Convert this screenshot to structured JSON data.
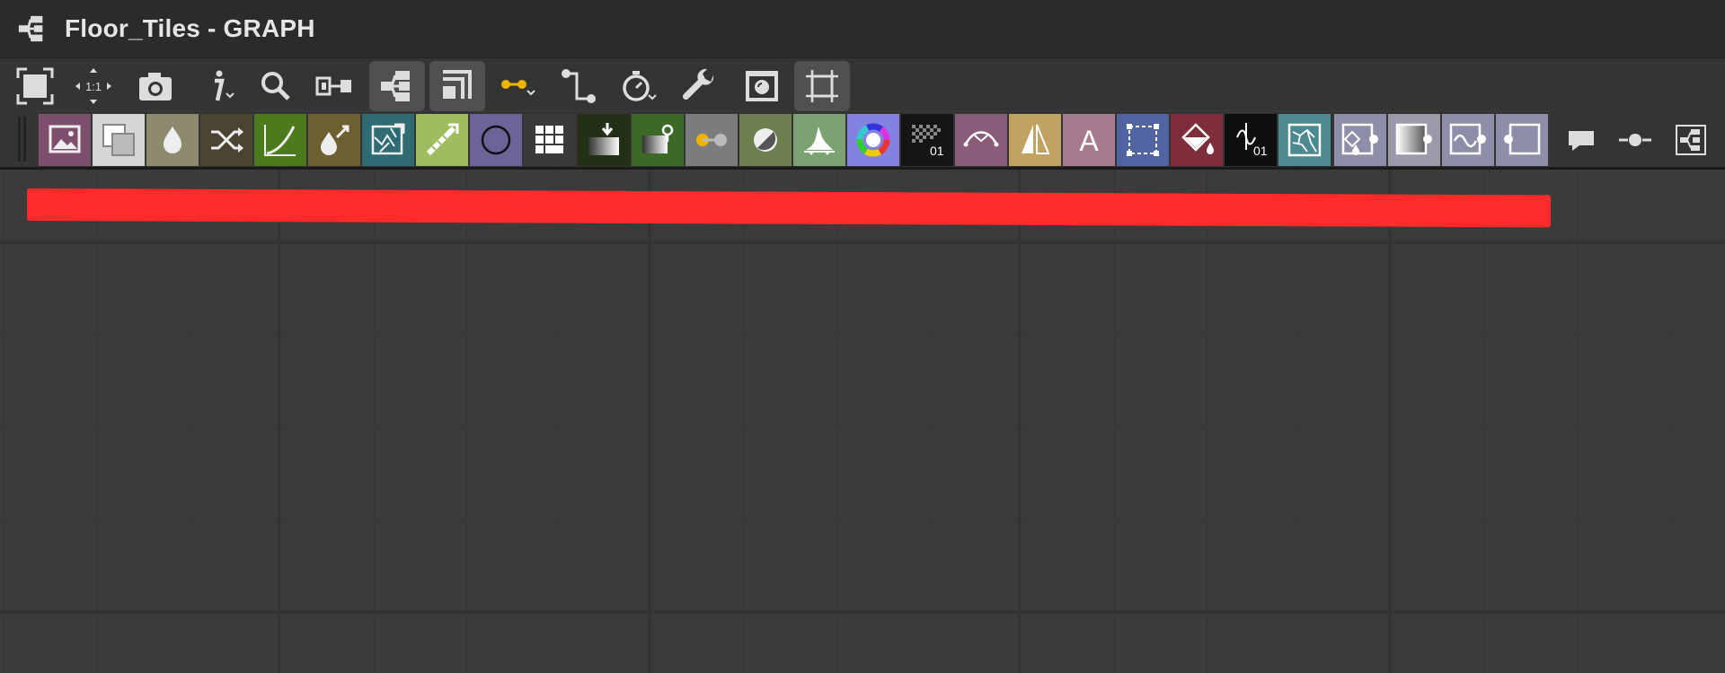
{
  "window": {
    "title": "Floor_Tiles - GRAPH",
    "title_icon": "graph-icon"
  },
  "toolbar_main": {
    "items": [
      {
        "name": "frame-all-icon",
        "active": false
      },
      {
        "name": "zoom-1-1-icon",
        "label": "1:1",
        "active": false
      },
      {
        "name": "screenshot-camera-icon",
        "active": false
      },
      {
        "name": "info-icon",
        "active": false
      },
      {
        "name": "search-icon",
        "active": false
      },
      {
        "name": "connector-icon",
        "active": false
      },
      {
        "name": "graph-layout-icon",
        "active": true
      },
      {
        "name": "stack-frames-icon",
        "active": true
      },
      {
        "name": "link-dropdown-icon",
        "active": false
      },
      {
        "name": "connection-style-icon",
        "active": false
      },
      {
        "name": "timer-icon",
        "active": false
      },
      {
        "name": "wrench-icon",
        "active": false
      },
      {
        "name": "preview-window-icon",
        "active": false
      },
      {
        "name": "frame-selection-icon",
        "active": true
      }
    ]
  },
  "toolbar_nodes": {
    "items": [
      {
        "name": "bitmap-node-icon",
        "color": "#7e4e6d"
      },
      {
        "name": "blend-node-icon",
        "color": "#d6d6d6"
      },
      {
        "name": "levels-drop-node-icon",
        "color": "#8d8a70"
      },
      {
        "name": "shuffle-node-icon",
        "color": "#4b4431"
      },
      {
        "name": "curve-node-icon",
        "color": "#4e7a1e"
      },
      {
        "name": "color-pick-node-icon",
        "color": "#6e6030"
      },
      {
        "name": "warp-node-icon",
        "color": "#2f6b72"
      },
      {
        "name": "gradient-node-icon",
        "color": "#9ebd5e"
      },
      {
        "name": "circle-shape-node-icon",
        "color": "#6c6398"
      },
      {
        "name": "grid-node-icon",
        "color": "#3a3a3a"
      },
      {
        "name": "input-node-icon",
        "color": "#233018"
      },
      {
        "name": "output-node-icon",
        "color": "#3c6a26"
      },
      {
        "name": "value-node-icon",
        "color": "#7c7c7c"
      },
      {
        "name": "grayscale-node-icon",
        "color": "#6b7f4f"
      },
      {
        "name": "histogram-node-icon",
        "color": "#7aa272"
      },
      {
        "name": "hsl-node-icon",
        "color": "#8482e0"
      },
      {
        "name": "noise-node-icon",
        "color": "#151515",
        "label": "01"
      },
      {
        "name": "bezier-node-icon",
        "color": "#8a5c7a"
      },
      {
        "name": "mirror-node-icon",
        "color": "#c2a260"
      },
      {
        "name": "text-node-icon",
        "color": "#a87a8e",
        "label": "A"
      },
      {
        "name": "transform-node-icon",
        "color": "#4f64a0"
      },
      {
        "name": "fill-node-icon",
        "color": "#7e2e3a"
      },
      {
        "name": "fx-map-node-icon",
        "color": "#0e0e0e",
        "label": "01"
      },
      {
        "name": "pattern-node-icon",
        "color": "#4c8a90"
      },
      {
        "name": "function-input-node-icon",
        "color": "#8f8ea8"
      },
      {
        "name": "function-gradient-node-icon",
        "color": "#9b9aaa"
      },
      {
        "name": "function-curve-node-icon",
        "color": "#8f8ea8"
      },
      {
        "name": "function-output-node-icon",
        "color": "#8f8ea8"
      }
    ],
    "trailing": [
      {
        "name": "comment-icon"
      },
      {
        "name": "pin-dot-icon"
      },
      {
        "name": "graph-small-icon"
      }
    ]
  },
  "canvas": {
    "annotation_color": "#ff2a2a"
  }
}
